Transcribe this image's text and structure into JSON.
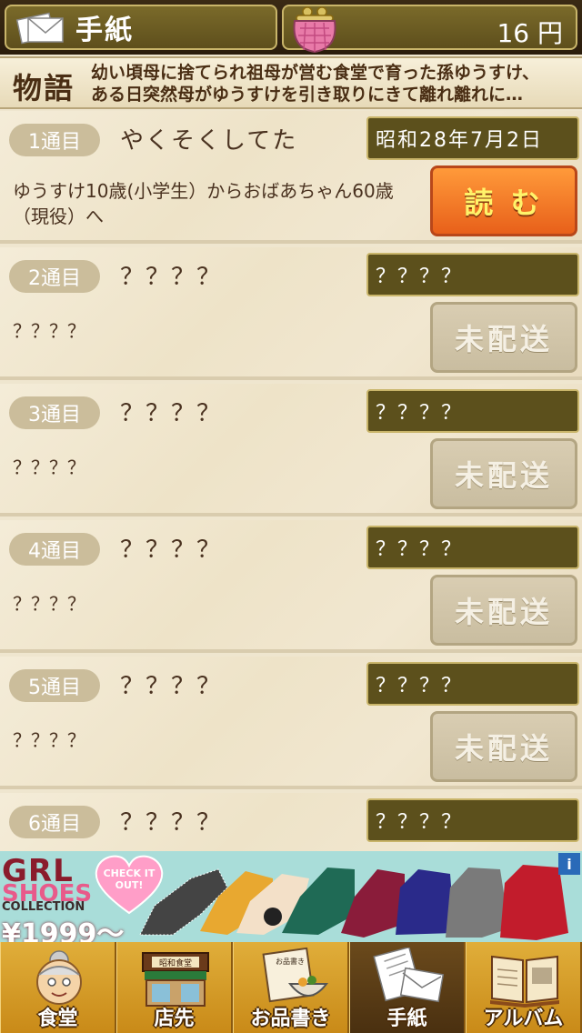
{
  "header": {
    "title": "手紙",
    "money_value": "16",
    "money_unit": "円",
    "title_icon": "envelope-icon",
    "money_icon": "purse-icon"
  },
  "story": {
    "label": "物語",
    "line1": "幼い頃母に捨てられ祖母が営む食堂で育った孫ゆうすけ、",
    "line2": "ある日突然母がゆうすけを引き取りにきて離れ離れに…"
  },
  "letters": [
    {
      "num": "1通目",
      "title": "やくそくしてた",
      "date": "昭和28年7月2日",
      "desc": "ゆうすけ10歳(小学生）からおばあちゃん60歳（現役）へ",
      "button": "読 む",
      "state": "read"
    },
    {
      "num": "2通目",
      "title": "？？？？",
      "date": "？？？？",
      "desc": "？？？？",
      "button": "未配送",
      "state": "pending"
    },
    {
      "num": "3通目",
      "title": "？？？？",
      "date": "？？？？",
      "desc": "？？？？",
      "button": "未配送",
      "state": "pending"
    },
    {
      "num": "4通目",
      "title": "？？？？",
      "date": "？？？？",
      "desc": "？？？？",
      "button": "未配送",
      "state": "pending"
    },
    {
      "num": "5通目",
      "title": "？？？？",
      "date": "？？？？",
      "desc": "？？？？",
      "button": "未配送",
      "state": "pending"
    },
    {
      "num": "6通目",
      "title": "？？？？",
      "date": "？？？？",
      "desc": "",
      "button": "",
      "state": "pending"
    }
  ],
  "ad": {
    "brand": "GRL",
    "sub": "SHOES",
    "collection": "COLLECTION",
    "price": "¥1999～",
    "heart_text": "CHECK IT OUT!",
    "info": "i",
    "colors": {
      "heart": "#ff9ec8",
      "brand": "#8a1c2c"
    }
  },
  "nav": {
    "items": [
      {
        "label": "食堂",
        "icon": "grandma-icon",
        "active": false
      },
      {
        "label": "店先",
        "icon": "storefront-icon",
        "active": false
      },
      {
        "label": "お品書き",
        "icon": "menu-bowl-icon",
        "active": false
      },
      {
        "label": "手紙",
        "icon": "letters-icon",
        "active": true
      },
      {
        "label": "アルバム",
        "icon": "album-icon",
        "active": false
      }
    ],
    "shop_sign": "昭和食堂",
    "menu_sign": "お品書き"
  },
  "colors": {
    "read_button": "#e8601a",
    "pending_button": "#c9bda0",
    "date_box": "#5c501c",
    "nav_bar": "#d89a28"
  }
}
